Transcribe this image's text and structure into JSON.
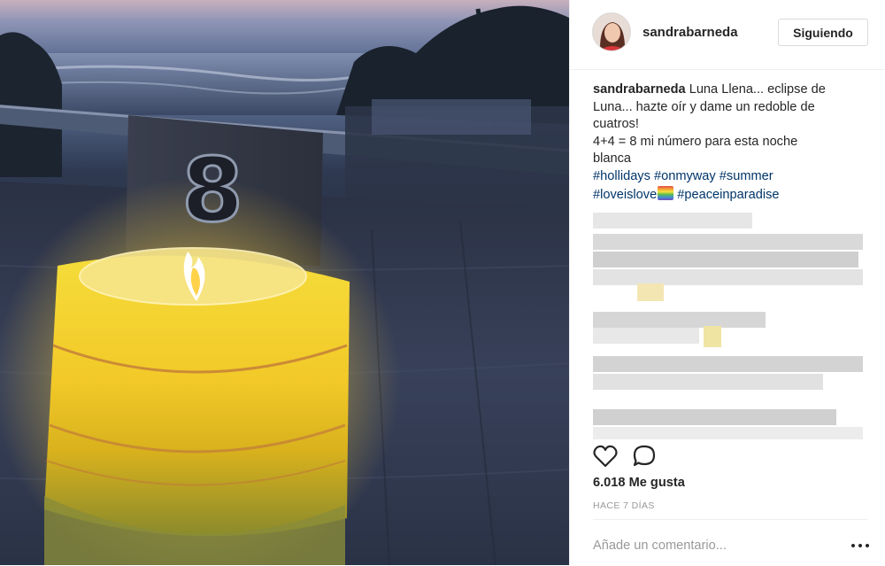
{
  "post": {
    "username": "sandrabarneda",
    "follow_label": "Siguiendo",
    "caption": {
      "user": "sandrabarneda",
      "line1": "Luna Llena... eclipse de",
      "line2": "Luna... hazte oír y dame un redoble de",
      "line3": "cuatros!",
      "line4": "4+4 = 8 mi número para esta noche",
      "line5": "blanca",
      "hashtags_row1": [
        "#hollidays",
        "#onmyway",
        "#summer"
      ],
      "hashtag_loveislove": "#loveislove",
      "hashtag_peace": "#peaceinparadise"
    },
    "table_number": "8",
    "likes": "6.018 Me gusta",
    "timestamp": "HACE 7 DÍAS",
    "comment_placeholder": "Añade un comentario..."
  },
  "icons": {
    "like": "heart-outline-icon",
    "comment": "speech-bubble-icon",
    "more": "ellipsis-icon",
    "emoji": "rainbow-flag-emoji"
  },
  "colors": {
    "hashtag": "#003569",
    "text": "#262626",
    "muted": "#999999",
    "border": "#dbdbdb",
    "candle_yellow": "#f2d02a"
  }
}
